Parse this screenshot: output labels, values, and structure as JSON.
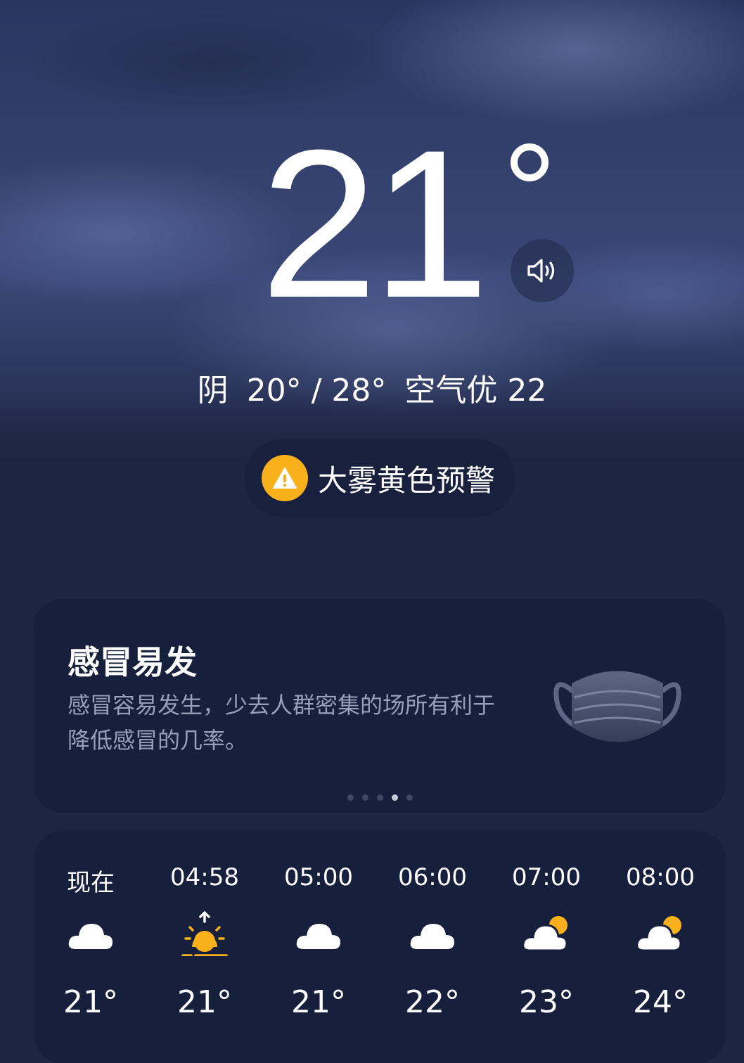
{
  "current": {
    "temperature": "21",
    "condition": "阴",
    "range": "20° / 28°",
    "air_quality": "空气优 22"
  },
  "alert": {
    "text": "大雾黄色预警",
    "color": "#f8b11a"
  },
  "tip": {
    "title": "感冒易发",
    "description": "感冒容易发生，少去人群密集的场所有利于降低感冒的几率。",
    "icon": "face-mask-icon",
    "page_count": 5,
    "active_page": 4
  },
  "hourly": [
    {
      "time": "现在",
      "icon": "cloud-icon",
      "temp": "21°"
    },
    {
      "time": "04:58",
      "icon": "sunrise-icon",
      "temp": "21°"
    },
    {
      "time": "05:00",
      "icon": "cloud-icon",
      "temp": "21°"
    },
    {
      "time": "06:00",
      "icon": "cloud-icon",
      "temp": "22°"
    },
    {
      "time": "07:00",
      "icon": "partly-cloudy-icon",
      "temp": "23°"
    },
    {
      "time": "08:00",
      "icon": "partly-cloudy-icon",
      "temp": "24°"
    }
  ],
  "colors": {
    "background": "#1d2543",
    "card": "#161f3b",
    "secondary_text": "#97a0b8",
    "sun": "#f8b11a"
  }
}
